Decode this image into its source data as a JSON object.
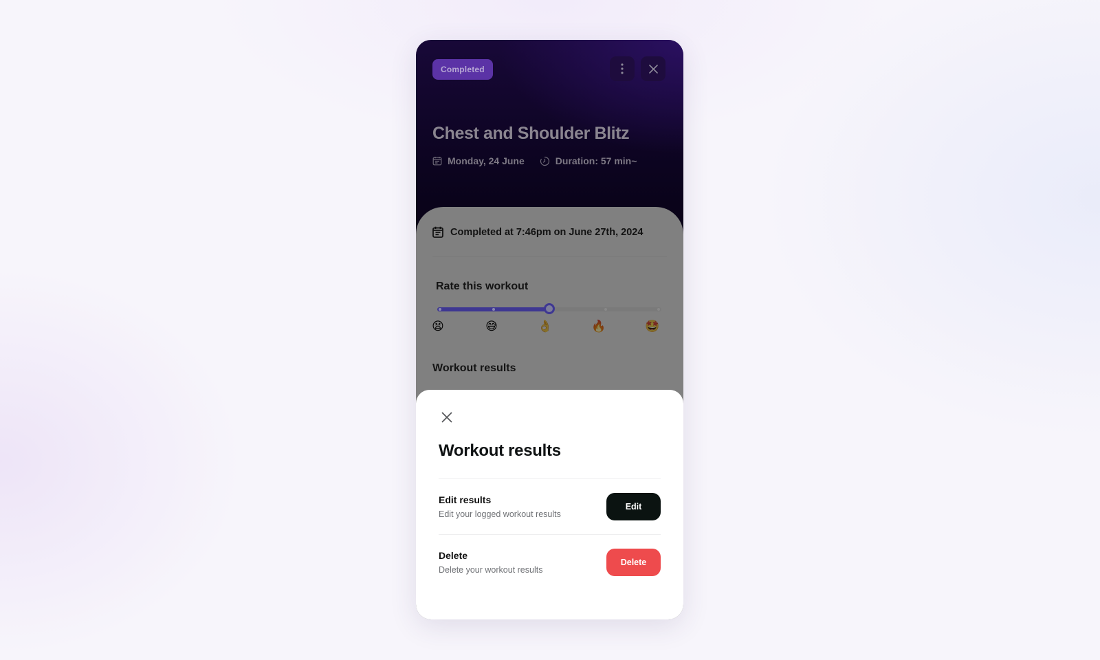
{
  "header": {
    "status_badge": "Completed",
    "title": "Chest and Shoulder Blitz",
    "date": "Monday, 24 June",
    "duration": "Duration: 57 min~",
    "icons": {
      "more": "vertical-ellipsis-icon",
      "close": "close-icon",
      "date": "calendar-icon",
      "duration": "timer-icon"
    }
  },
  "details": {
    "completed_text": "Completed at 7:46pm on June 27th, 2024",
    "rating": {
      "title": "Rate this workout",
      "steps": 5,
      "selected_index": 2,
      "value_fraction": 0.5,
      "emojis": [
        "😫",
        "😅",
        "👌",
        "🔥",
        "🤩"
      ]
    },
    "results_heading": "Workout results"
  },
  "sheet": {
    "title": "Workout results",
    "close_icon": "close-icon",
    "options": [
      {
        "label": "Edit results",
        "description": "Edit your logged workout results",
        "button": "Edit",
        "button_color": "#0b1311"
      },
      {
        "label": "Delete",
        "description": "Delete your workout results",
        "button": "Delete",
        "button_color": "#ee4b4d"
      }
    ]
  },
  "colors": {
    "accent": "#3e3792",
    "badge": "#5b33a6",
    "danger": "#ee4b4d",
    "dark_button": "#0b1311"
  }
}
